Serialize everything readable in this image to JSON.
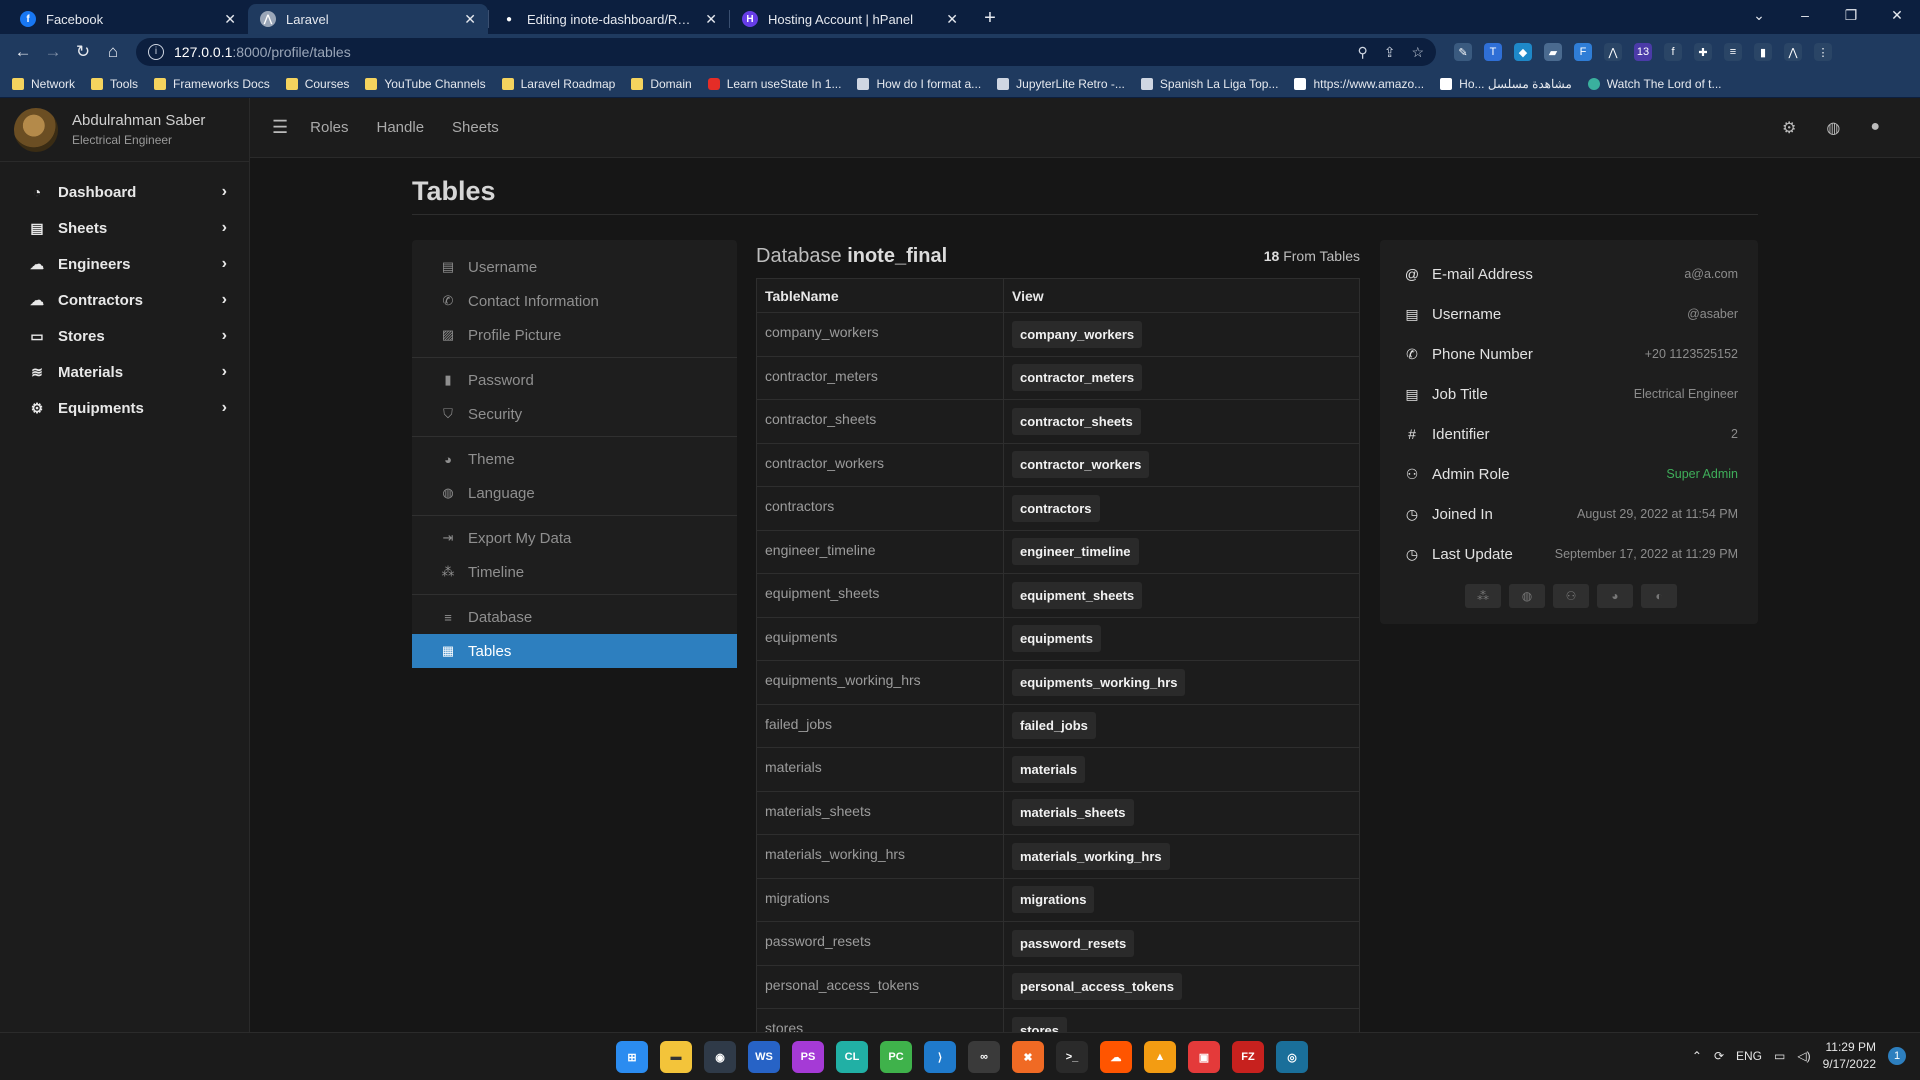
{
  "browser": {
    "tabs": [
      {
        "title": "Facebook",
        "icon": "facebook-icon",
        "color": "#1877f2"
      },
      {
        "title": "Laravel",
        "icon": "laravel-icon",
        "color": "#9aa6b8"
      },
      {
        "title": "Editing inote-dashboard/READM",
        "icon": "github-icon",
        "color": "#ffffff"
      },
      {
        "title": "Hosting Account | hPanel",
        "icon": "hostinger-icon",
        "color": "#673de6"
      }
    ],
    "url_host": "127.0.0.1",
    "url_path": ":8000/profile/tables",
    "bookmarks": [
      {
        "label": "Network",
        "type": "folder"
      },
      {
        "label": "Tools",
        "type": "folder"
      },
      {
        "label": "Frameworks Docs",
        "type": "folder"
      },
      {
        "label": "Courses",
        "type": "folder"
      },
      {
        "label": "YouTube Channels",
        "type": "folder"
      },
      {
        "label": "Laravel Roadmap",
        "type": "folder"
      },
      {
        "label": "Domain",
        "type": "folder"
      },
      {
        "label": "Learn useState In 1...",
        "type": "yt"
      },
      {
        "label": "How do I format a...",
        "type": "gray"
      },
      {
        "label": "JupyterLite Retro -...",
        "type": "gray"
      },
      {
        "label": "Spanish La Liga Top...",
        "type": "gray"
      },
      {
        "label": "https://www.amazo...",
        "type": "amz"
      },
      {
        "label": "Ho... مشاهدة مسلسل",
        "type": "amz"
      },
      {
        "label": "Watch The Lord of t...",
        "type": "teal"
      }
    ]
  },
  "sidebar": {
    "user_name": "Abdulrahman Saber",
    "user_role": "Electrical Engineer",
    "items": [
      {
        "label": "Dashboard",
        "icon": "dashboard-icon"
      },
      {
        "label": "Sheets",
        "icon": "file-icon"
      },
      {
        "label": "Engineers",
        "icon": "helmet-icon"
      },
      {
        "label": "Contractors",
        "icon": "helmet-icon"
      },
      {
        "label": "Stores",
        "icon": "store-icon"
      },
      {
        "label": "Materials",
        "icon": "layers-icon"
      },
      {
        "label": "Equipments",
        "icon": "gears-icon"
      }
    ]
  },
  "topnav": {
    "links": [
      "Roles",
      "Handle",
      "Sheets"
    ]
  },
  "page": {
    "title": "Tables"
  },
  "settings_menu": {
    "groups": [
      [
        {
          "label": "Username",
          "icon": "id-card-icon",
          "active": false
        },
        {
          "label": "Contact Information",
          "icon": "phone-icon",
          "active": false
        },
        {
          "label": "Profile Picture",
          "icon": "image-icon",
          "active": false
        }
      ],
      [
        {
          "label": "Password",
          "icon": "lock-icon",
          "active": false
        },
        {
          "label": "Security",
          "icon": "shield-icon",
          "active": false
        }
      ],
      [
        {
          "label": "Theme",
          "icon": "palette-icon",
          "active": false
        },
        {
          "label": "Language",
          "icon": "globe-icon",
          "active": false
        }
      ],
      [
        {
          "label": "Export My Data",
          "icon": "file-export-icon",
          "active": false
        },
        {
          "label": "Timeline",
          "icon": "timeline-icon",
          "active": false
        }
      ],
      [
        {
          "label": "Database",
          "icon": "database-icon",
          "active": false
        },
        {
          "label": "Tables",
          "icon": "table-icon",
          "active": true
        }
      ]
    ]
  },
  "database": {
    "label_prefix": "Database",
    "name": "inote_final",
    "count": "18",
    "count_suffix": "From Tables",
    "columns": [
      "TableName",
      "View"
    ],
    "tables": [
      "company_workers",
      "contractor_meters",
      "contractor_sheets",
      "contractor_workers",
      "contractors",
      "engineer_timeline",
      "equipment_sheets",
      "equipments",
      "equipments_working_hrs",
      "failed_jobs",
      "materials",
      "materials_sheets",
      "materials_working_hrs",
      "migrations",
      "password_resets",
      "personal_access_tokens",
      "stores"
    ]
  },
  "account": {
    "rows": [
      {
        "label": "E-mail Address",
        "value": "a@a.com",
        "icon": "at-icon",
        "green": false
      },
      {
        "label": "Username",
        "value": "@asaber",
        "icon": "id-card-icon",
        "green": false
      },
      {
        "label": "Phone Number",
        "value": "+20 1123525152",
        "icon": "phone-icon",
        "green": false
      },
      {
        "label": "Job Title",
        "value": "Electrical Engineer",
        "icon": "id-card-icon",
        "green": false
      },
      {
        "label": "Identifier",
        "value": "2",
        "icon": "hash-icon",
        "green": false
      },
      {
        "label": "Admin Role",
        "value": "Super Admin",
        "icon": "user-cog-icon",
        "green": true
      },
      {
        "label": "Joined In",
        "value": "August 29, 2022 at 11:54 PM",
        "icon": "clock-icon",
        "green": false
      },
      {
        "label": "Last Update",
        "value": "September 17, 2022 at 11:29 PM",
        "icon": "clock-icon",
        "green": false
      }
    ],
    "actions": [
      "timeline-icon",
      "globe-icon",
      "users-icon",
      "palette-icon",
      "language-icon"
    ]
  },
  "taskbar": {
    "lang": "ENG",
    "time": "11:29 PM",
    "date": "9/17/2022",
    "notifications": "1"
  },
  "colors": {
    "accent": "#2d7fbf",
    "admin_role": "#3fae5a",
    "chrome_dark": "#0c1f3f",
    "chrome": "#1f3a5f"
  }
}
